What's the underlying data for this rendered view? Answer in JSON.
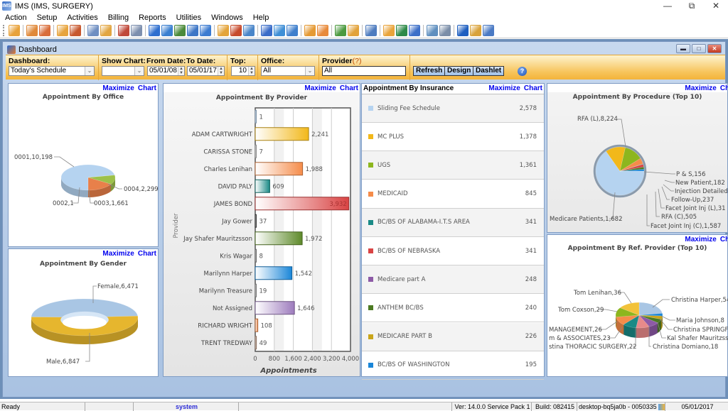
{
  "window": {
    "title": "IMS (IMS, SURGERY)",
    "controls": [
      "minimize",
      "restore",
      "close"
    ]
  },
  "menu": [
    "Action",
    "Setup",
    "Activities",
    "Billing",
    "Reports",
    "Utilities",
    "Windows",
    "Help"
  ],
  "toolbar": {
    "icons": [
      {
        "name": "patient-icon",
        "color": "#e8a23a"
      },
      {
        "sep": true
      },
      {
        "name": "provider-icon",
        "color": "#e0893a"
      },
      {
        "name": "provider-check-icon",
        "color": "#d96d3a"
      },
      {
        "sep": true
      },
      {
        "name": "folder-icon",
        "color": "#e7a43c"
      },
      {
        "name": "edit-record-icon",
        "color": "#c7582e"
      },
      {
        "sep": true
      },
      {
        "name": "prescription-icon",
        "color": "#6f8fc2"
      },
      {
        "name": "lab-flask-icon",
        "color": "#e2a642"
      },
      {
        "sep": true
      },
      {
        "name": "document-icon",
        "color": "#c0493a"
      },
      {
        "name": "notes-icon",
        "color": "#7d8fae"
      },
      {
        "sep": true
      },
      {
        "name": "billing-icon",
        "color": "#2f6fcf"
      },
      {
        "name": "billing-folder-icon",
        "color": "#3a7fd0"
      },
      {
        "name": "billing-users-icon",
        "color": "#4b8a3a"
      },
      {
        "name": "payment-icon",
        "color": "#3c76c6"
      },
      {
        "name": "claims-icon",
        "color": "#3b7bd1"
      },
      {
        "sep": true
      },
      {
        "name": "calendar-icon",
        "color": "#e4a43a"
      },
      {
        "name": "scheduler-icon",
        "color": "#c74a2c"
      },
      {
        "name": "report-icon",
        "color": "#4a86c9"
      },
      {
        "sep": true
      },
      {
        "name": "back-icon",
        "color": "#3a6cc8"
      },
      {
        "name": "import-icon",
        "color": "#3f8fd6"
      },
      {
        "name": "export-icon",
        "color": "#3f7fcc"
      },
      {
        "sep": true
      },
      {
        "name": "calendar-clock-icon",
        "color": "#e59a34"
      },
      {
        "name": "clipboard-icon",
        "color": "#e88a3a"
      },
      {
        "sep": true
      },
      {
        "name": "chart-icon",
        "color": "#4c9a3f"
      },
      {
        "name": "contacts-icon",
        "color": "#e2a23a"
      },
      {
        "sep": true
      },
      {
        "name": "reports-icon",
        "color": "#4e7cbf"
      },
      {
        "sep": true
      },
      {
        "name": "refresh-icon",
        "color": "#e9a43b"
      },
      {
        "name": "transfer-icon",
        "color": "#2e8a48"
      },
      {
        "name": "spell-check-icon",
        "color": "#3c6fc8"
      },
      {
        "sep": true
      },
      {
        "name": "window-icon",
        "color": "#5f8fbf"
      },
      {
        "name": "text-icon",
        "color": "#7b8ea8"
      },
      {
        "sep": true
      },
      {
        "name": "help-icon",
        "color": "#1f5fc0"
      },
      {
        "name": "lock-icon",
        "color": "#d9a23a"
      },
      {
        "name": "exit-icon",
        "color": "#4a7ac4"
      }
    ]
  },
  "dashboard": {
    "title": "Dashboard",
    "filters": {
      "dashboard_label": "Dashboard:",
      "dashboard_value": "Today's Schedule",
      "show_chart_label": "Show Chart:",
      "show_chart_value": "",
      "from_date_label": "From Date:",
      "from_date_value": "05/01/08",
      "to_date_label": "To Date:",
      "to_date_value": "05/01/17",
      "top_label": "Top:",
      "top_value": "10",
      "office_label": "Office:",
      "office_value": "All",
      "provider_label": "Provider",
      "provider_hint": "(?)",
      "provider_value": "All"
    },
    "buttons": {
      "refresh": "Refresh",
      "design": "Design",
      "dashlet": "Dashlet"
    },
    "maximize": "Maximize",
    "chart": "Chart"
  },
  "chart_data": [
    {
      "type": "pie",
      "title": "Appointment By Office",
      "labels": [
        "0001",
        "0002",
        "0003",
        "0004"
      ],
      "values": [
        10198,
        1,
        1661,
        2299
      ],
      "display": [
        "0001,10,198",
        "0002,1",
        "0003,1,661",
        "0004,2,299"
      ],
      "colors": [
        "#b5d3f0",
        "#d0d0d0",
        "#9dc14a",
        "#e8804a"
      ]
    },
    {
      "type": "pie",
      "title": "Appointment By Gender",
      "labels": [
        "Female",
        "Male"
      ],
      "values": [
        6471,
        6847
      ],
      "display": [
        "Female,6,471",
        "Male,6,847"
      ],
      "colors": [
        "#a9c6e4",
        "#e6b62e"
      ]
    },
    {
      "type": "bar",
      "title": "Appointment By Provider",
      "categories": [
        "",
        "ADAM CARTWRIGHT",
        "CARISSA STONE",
        "Charles Lenihan",
        "DAVID PALY",
        "JAMES BOND",
        "Jay Gower",
        "Jay Shafer Mauritzsson",
        "Kris Wagar",
        "Marilynn Harper",
        "Marilynn Treasure",
        "Not Assigned",
        "RICHARD WRIGHT",
        "TRENT TREDWAY"
      ],
      "values": [
        1,
        2241,
        7,
        1988,
        609,
        3932,
        37,
        1972,
        8,
        1542,
        19,
        1646,
        108,
        49
      ],
      "display": [
        "1",
        "2,241",
        "7",
        "1,988",
        "609",
        "3,932",
        "37",
        "1,972",
        "8",
        "1,542",
        "19",
        "1,646",
        "108",
        "49"
      ],
      "colors": [
        "#b5d3f0",
        "#f2b81a",
        "#c8c8c8",
        "#f58c4a",
        "#1a8a86",
        "#d94444",
        "#555555",
        "#5e8a2a",
        "#999999",
        "#1a86d8",
        "#aaaaaa",
        "#9d7bbd",
        "#f08a4a",
        "#c4a08a"
      ],
      "xlabel": "Appointments",
      "ylabel": "Provider",
      "xlim": [
        0,
        4000
      ],
      "xticks": [
        "0",
        "800",
        "1,600",
        "2,400",
        "3,200",
        "4,000"
      ],
      "tick_values": [
        0,
        800,
        1600,
        2400,
        3200,
        4000
      ],
      "grid": true
    },
    {
      "type": "table",
      "title": "Appointment By Insurance",
      "rows": [
        {
          "name": "Sliding Fee Schedule",
          "value": "2,578",
          "color": "#b5d3f0"
        },
        {
          "name": "MC PLUS",
          "value": "1,378",
          "color": "#f2b81a"
        },
        {
          "name": "UGS",
          "value": "1,361",
          "color": "#8db61e"
        },
        {
          "name": "MEDICAID",
          "value": "845",
          "color": "#f58c4a"
        },
        {
          "name": "BC/BS OF ALABAMA-I.T.S AREA",
          "value": "341",
          "color": "#1a8a86"
        },
        {
          "name": "BC/BS OF NEBRASKA",
          "value": "341",
          "color": "#d94444"
        },
        {
          "name": "Medicare part A",
          "value": "248",
          "color": "#8d5aa6"
        },
        {
          "name": "ANTHEM BC/BS",
          "value": "240",
          "color": "#4c7a22"
        },
        {
          "name": "MEDICARE PART B",
          "value": "226",
          "color": "#c9a51a"
        },
        {
          "name": "BC/BS OF WASHINGTON",
          "value": "195",
          "color": "#1a86d8"
        }
      ]
    },
    {
      "type": "pie",
      "title": "Appointment By Procedure (Top 10)",
      "labels": [
        "RFA (L)",
        "Medicare Patients",
        "Facet Joint Inj (C)",
        "RFA (C)",
        "Facet Joint Inj (L)",
        "Follow-Up",
        "Injection Detailed",
        "New Patient",
        "P & S"
      ],
      "values": [
        8224,
        1682,
        1587,
        505,
        31,
        237,
        0,
        182,
        156
      ],
      "display": [
        "RFA (L),8,224",
        "Medicare Patients,1,682",
        "Facet Joint Inj (C),1,587",
        "RFA (C),505",
        "Facet Joint Inj (L),31",
        "Follow-Up,237",
        "Injection Detailed,",
        "New Patient,182",
        "P & S,156"
      ],
      "colors": [
        "#b5d3f0",
        "#f2b81a",
        "#8db61e",
        "#f58c4a",
        "#1a8a86",
        "#d94444",
        "#8d5aa6",
        "#4c7a22",
        "#1a86d8"
      ]
    },
    {
      "type": "pie",
      "title": "Appointment By Ref. Provider (Top 10)",
      "labels": [
        "Christina Harper",
        "Maria Johnson",
        "Christina SPRINGF",
        "Kal Shafer Mauritzsso",
        "Christina Domiano",
        "stina THORACIC SURGERY",
        "m & ASSOCIATES",
        "MANAGEMENT",
        "Tom Coxson",
        "Tom Lenihan"
      ],
      "values": [
        54,
        8,
        10,
        12,
        18,
        22,
        23,
        26,
        29,
        36
      ],
      "display": [
        "Christina Harper,54",
        "Maria Johnson,8",
        "Christina SPRINGF",
        "Kal Shafer Mauritzsso",
        "Christina Domiano,18",
        "stina THORACIC SURGERY,22",
        "m & ASSOCIATES,23",
        "MANAGEMENT,26",
        "Tom Coxson,29",
        "Tom Lenihan,36"
      ],
      "colors": [
        "#a9c6e4",
        "#1a86d8",
        "#c9a51a",
        "#4c7a22",
        "#8d5aa6",
        "#e88a8a",
        "#1a8a86",
        "#f58c4a",
        "#8db61e",
        "#f2c23a"
      ]
    }
  ],
  "statusbar": {
    "status": "Ready",
    "user": "system",
    "version": "Ver: 14.0.0 Service Pack 1",
    "build": "Build: 082415",
    "machine": "desktop-bq5ja0b - 0050335",
    "date": "05/01/2017"
  }
}
